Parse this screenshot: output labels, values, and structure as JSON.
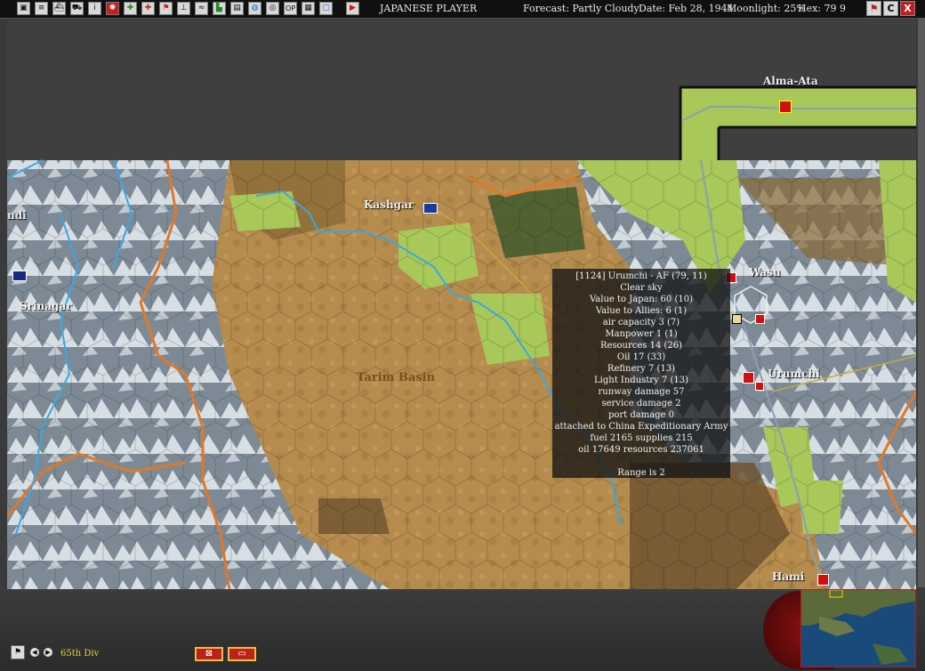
{
  "toolbar": {
    "player": "JAPANESE PLAYER",
    "forecast": "Forecast: Partly Cloudy",
    "date": "Date: Feb 28, 1944",
    "moonlight": "Moonlight: 25%",
    "hex": "Hex: 79 9",
    "buttons": [
      "map-icon",
      "list-icon",
      "ship-icon",
      "truck-icon",
      "info-icon",
      "rising-sun-icon",
      "aircraft-icon",
      "ground-unit-icon",
      "flag-icon",
      "airfield-icon",
      "supply-icon",
      "factory-icon",
      "globe-icon",
      "target-icon",
      "op-icon",
      "report-icon",
      "screen-icon",
      "end-turn-icon"
    ],
    "op_label": "OP",
    "info_label": "i",
    "close_label": "X",
    "restore_label": "C"
  },
  "map_labels": {
    "alma_ata": "Alma-Ata",
    "kashgar": "Kashgar",
    "wasu": "Wasu",
    "urumchi": "Urumchi",
    "srinagar": "Srinagar",
    "tarim": "Tarim Basin",
    "hami": "Hami",
    "indi": "ndi"
  },
  "tooltip": {
    "lines": [
      "[1124] Urumchi - AF (79, 11)",
      "Clear sky",
      "Value to Japan: 60 (10)",
      "Value to Allies: 6 (1)",
      "air capacity 3 (7)",
      "Manpower  1 (1)",
      "Resources  14 (26)",
      "Oil  17 (33)",
      "Refinery  7 (13)",
      "Light Industry  7 (13)",
      "runway damage 57",
      "service damage 2",
      "port damage 0",
      "attached to China Expeditionary Army",
      "fuel 2165  supplies 215",
      "oil 17649  resources 237061",
      "",
      "Range is 2"
    ]
  },
  "bottom": {
    "unit": "65th Div"
  },
  "colors": {
    "terrain_desert": "#b08a4c",
    "terrain_clear": "#a8c85a",
    "terrain_mountain": "#9aa6b0",
    "river": "#3aa8e0",
    "border": "#e07828"
  }
}
